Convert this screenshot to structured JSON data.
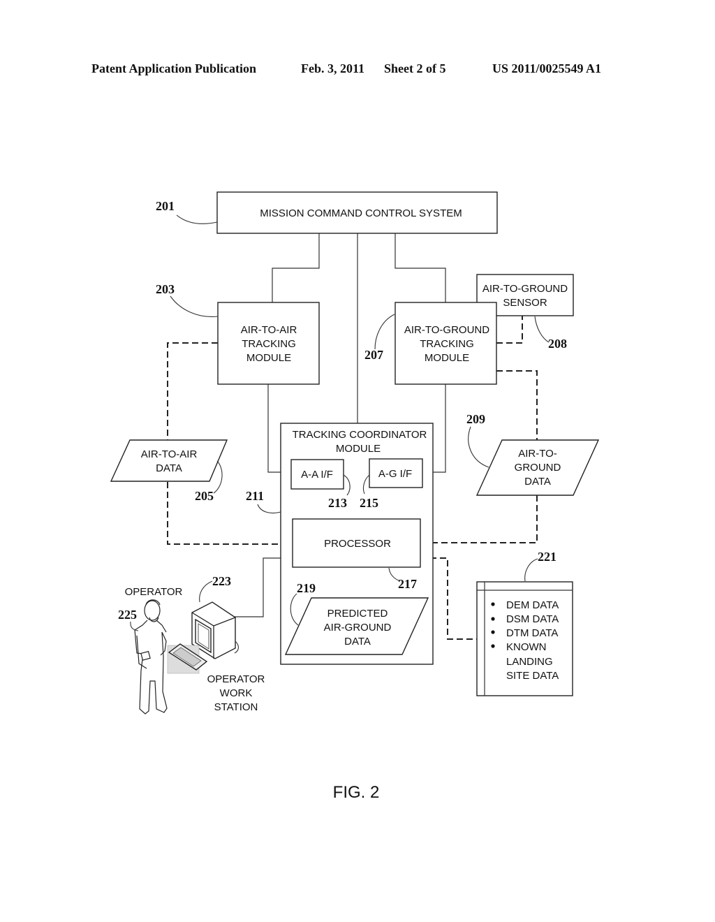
{
  "header": {
    "publication": "Patent Application Publication",
    "date": "Feb. 3, 2011",
    "sheet": "Sheet 2 of 5",
    "number": "US 2011/0025549 A1"
  },
  "diagram": {
    "mission_command": {
      "label": "MISSION COMMAND CONTROL SYSTEM",
      "ref": "201"
    },
    "air_to_air_tracking": {
      "lines": [
        "AIR-TO-AIR",
        "TRACKING",
        "MODULE"
      ],
      "ref": "203"
    },
    "air_to_air_data": {
      "lines": [
        "AIR-TO-AIR",
        "DATA"
      ],
      "ref": "205"
    },
    "air_to_ground_tracking": {
      "lines": [
        "AIR-TO-GROUND",
        "TRACKING",
        "MODULE"
      ],
      "ref": "207"
    },
    "air_to_ground_sensor": {
      "lines": [
        "AIR-TO-GROUND",
        "SENSOR"
      ],
      "ref": "208"
    },
    "air_to_ground_data": {
      "lines": [
        "AIR-TO-",
        "GROUND",
        "DATA"
      ],
      "ref": "209"
    },
    "tracking_coordinator": {
      "lines": [
        "TRACKING COORDINATOR",
        "MODULE"
      ],
      "ref": "211"
    },
    "aa_interface": {
      "label": "A-A I/F",
      "ref": "213"
    },
    "ag_interface": {
      "label": "A-G I/F",
      "ref": "215"
    },
    "processor": {
      "label": "PROCESSOR",
      "ref": "217"
    },
    "predicted_data": {
      "lines": [
        "PREDICTED",
        "AIR-GROUND",
        "DATA"
      ],
      "ref": "219"
    },
    "database": {
      "ref": "221",
      "items": [
        "DEM DATA",
        "DSM DATA",
        "DTM DATA",
        "KNOWN",
        "LANDING",
        "SITE DATA"
      ]
    },
    "workstation": {
      "lines": [
        "OPERATOR",
        "WORK",
        "STATION"
      ],
      "ref": "223"
    },
    "operator": {
      "label": "OPERATOR",
      "ref": "225"
    }
  },
  "figure_caption": "FIG. 2"
}
